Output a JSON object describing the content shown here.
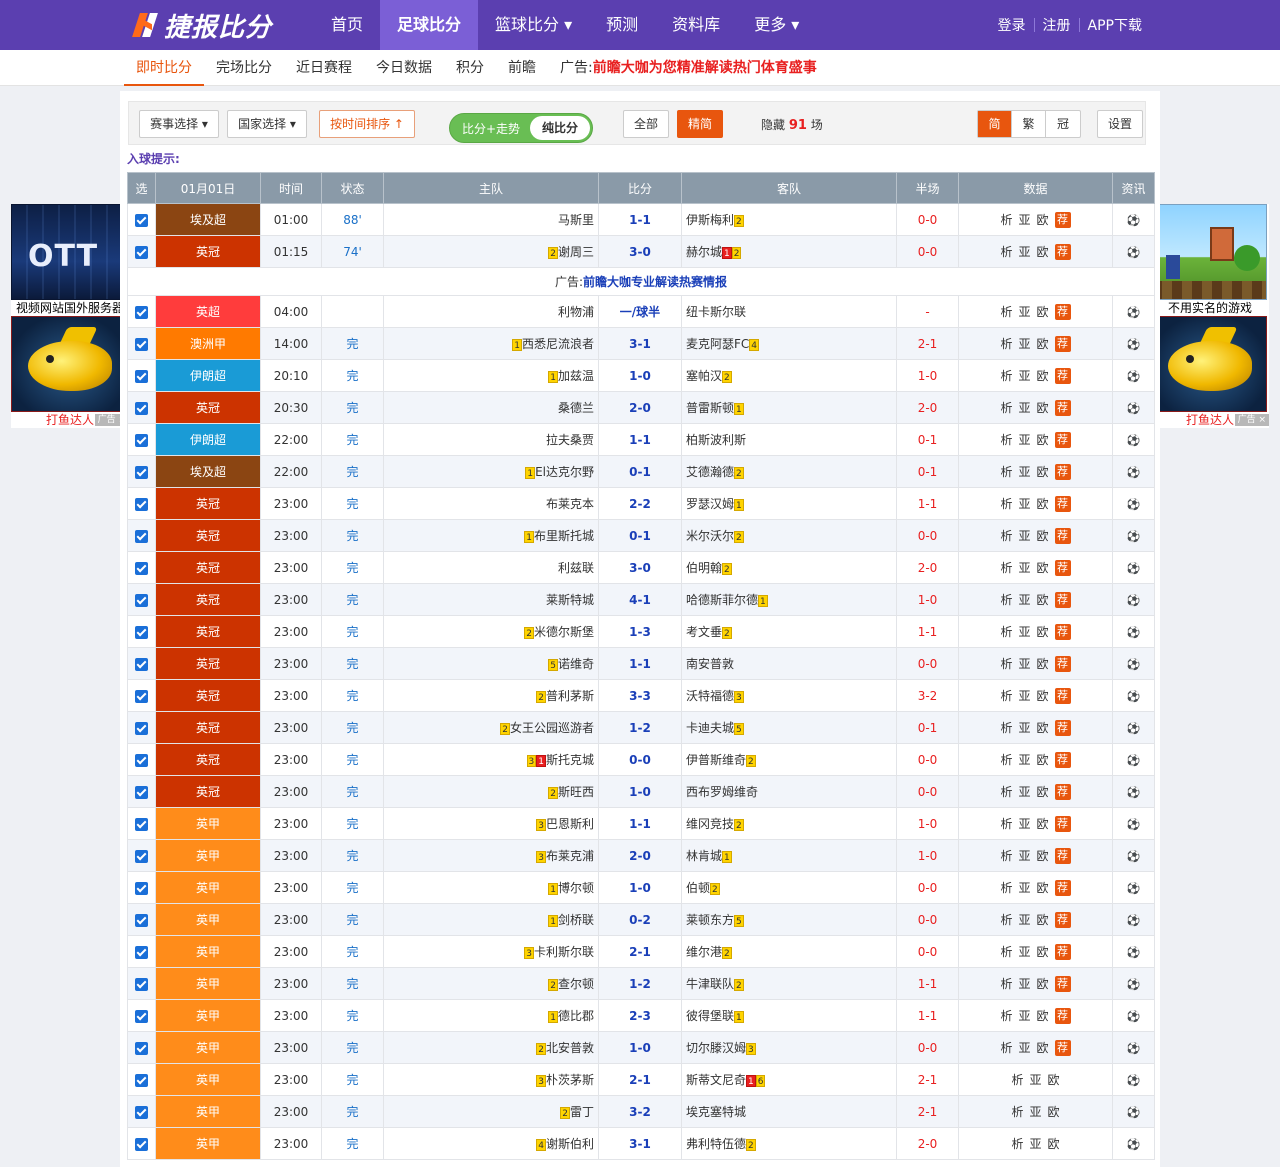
{
  "header": {
    "logo_text": "捷报比分",
    "nav": [
      {
        "label": "首页",
        "active": false
      },
      {
        "label": "足球比分",
        "active": true
      },
      {
        "label": "篮球比分 ▾",
        "active": false
      },
      {
        "label": "预测",
        "active": false
      },
      {
        "label": "资料库",
        "active": false
      },
      {
        "label": "更多 ▾",
        "active": false
      }
    ],
    "right_links": [
      "登录",
      "注册",
      "APP下载"
    ]
  },
  "subnav": {
    "items": [
      "即时比分",
      "完场比分",
      "近日赛程",
      "今日数据",
      "积分",
      "前瞻"
    ],
    "ad_prefix": "广告:",
    "ad_text": "前瞻大咖为您精准解读热门体育盛事"
  },
  "toolbar": {
    "match_select": "赛事选择 ▾",
    "country_select": "国家选择 ▾",
    "sort_by_time": "按时间排序 ↑",
    "toggle_option1": "比分+走势",
    "toggle_option2": "纯比分",
    "all": "全部",
    "featured": "精简",
    "hidden_prefix": "隐藏",
    "hidden_count": "91",
    "hidden_suffix": "场",
    "lang": [
      "简",
      "繁",
      "冠"
    ],
    "settings": "设置"
  },
  "goal_tip": "入球提示:",
  "table": {
    "headers": [
      "选",
      "01月01日",
      "时间",
      "状态",
      "主队",
      "比分",
      "客队",
      "半场",
      "数据",
      "资讯"
    ],
    "data_links": [
      "析",
      "亚",
      "欧"
    ],
    "rec_label": "荐",
    "ad_row": {
      "prefix": "广告:",
      "text": "前瞻大咖专业解读热赛情报"
    },
    "league_colors": {
      "埃及超": "#8b4512",
      "英冠": "#cc3300",
      "英超": "#ff3c3c",
      "澳洲甲": "#ff7a00",
      "伊朗超": "#1a9bd6",
      "英甲": "#ff8c1a"
    },
    "rows_top": [
      {
        "league": "埃及超",
        "time": "01:00",
        "status": "88'",
        "home": "马斯里",
        "home_cards": [],
        "score": "1-1",
        "away": "伊斯梅利",
        "away_cards": [
          {
            "t": "y",
            "n": "2"
          }
        ],
        "ht": "0-0",
        "rec": true
      },
      {
        "league": "英冠",
        "time": "01:15",
        "status": "74'",
        "home": "谢周三",
        "home_cards": [
          {
            "t": "y",
            "n": "2"
          }
        ],
        "score": "3-0",
        "away": "赫尔城",
        "away_cards": [
          {
            "t": "r",
            "n": "1"
          },
          {
            "t": "y",
            "n": "2"
          }
        ],
        "ht": "0-0",
        "rec": true
      }
    ],
    "rows": [
      {
        "league": "英超",
        "time": "04:00",
        "status": "",
        "home": "利物浦",
        "home_cards": [],
        "score": "一/球半",
        "away": "纽卡斯尔联",
        "away_cards": [],
        "ht": "-",
        "rec": true
      },
      {
        "league": "澳洲甲",
        "time": "14:00",
        "status": "完",
        "home": "西悉尼流浪者",
        "home_cards": [
          {
            "t": "y",
            "n": "1"
          }
        ],
        "score": "3-1",
        "away": "麦克阿瑟FC",
        "away_cards": [
          {
            "t": "y",
            "n": "4"
          }
        ],
        "ht": "2-1",
        "rec": true
      },
      {
        "league": "伊朗超",
        "time": "20:10",
        "status": "完",
        "home": "加兹温",
        "home_cards": [
          {
            "t": "y",
            "n": "1"
          }
        ],
        "score": "1-0",
        "away": "塞帕汉",
        "away_cards": [
          {
            "t": "y",
            "n": "2"
          }
        ],
        "ht": "1-0",
        "rec": true
      },
      {
        "league": "英冠",
        "time": "20:30",
        "status": "完",
        "home": "桑德兰",
        "home_cards": [],
        "score": "2-0",
        "away": "普雷斯顿",
        "away_cards": [
          {
            "t": "y",
            "n": "1"
          }
        ],
        "ht": "2-0",
        "rec": true
      },
      {
        "league": "伊朗超",
        "time": "22:00",
        "status": "完",
        "home": "拉夫桑贾",
        "home_cards": [],
        "score": "1-1",
        "away": "柏斯波利斯",
        "away_cards": [],
        "ht": "0-1",
        "rec": true
      },
      {
        "league": "埃及超",
        "time": "22:00",
        "status": "完",
        "home": "El达克尔野",
        "home_cards": [
          {
            "t": "y",
            "n": "1"
          }
        ],
        "score": "0-1",
        "away": "艾德瀚德",
        "away_cards": [
          {
            "t": "y",
            "n": "2"
          }
        ],
        "ht": "0-1",
        "rec": true
      },
      {
        "league": "英冠",
        "time": "23:00",
        "status": "完",
        "home": "布莱克本",
        "home_cards": [],
        "score": "2-2",
        "away": "罗瑟汉姆",
        "away_cards": [
          {
            "t": "y",
            "n": "1"
          }
        ],
        "ht": "1-1",
        "rec": true
      },
      {
        "league": "英冠",
        "time": "23:00",
        "status": "完",
        "home": "布里斯托城",
        "home_cards": [
          {
            "t": "y",
            "n": "1"
          }
        ],
        "score": "0-1",
        "away": "米尔沃尔",
        "away_cards": [
          {
            "t": "y",
            "n": "2"
          }
        ],
        "ht": "0-0",
        "rec": true
      },
      {
        "league": "英冠",
        "time": "23:00",
        "status": "完",
        "home": "利兹联",
        "home_cards": [],
        "score": "3-0",
        "away": "伯明翰",
        "away_cards": [
          {
            "t": "y",
            "n": "2"
          }
        ],
        "ht": "2-0",
        "rec": true
      },
      {
        "league": "英冠",
        "time": "23:00",
        "status": "完",
        "home": "莱斯特城",
        "home_cards": [],
        "score": "4-1",
        "away": "哈德斯菲尔德",
        "away_cards": [
          {
            "t": "y",
            "n": "1"
          }
        ],
        "ht": "1-0",
        "rec": true
      },
      {
        "league": "英冠",
        "time": "23:00",
        "status": "完",
        "home": "米德尔斯堡",
        "home_cards": [
          {
            "t": "y",
            "n": "2"
          }
        ],
        "score": "1-3",
        "away": "考文垂",
        "away_cards": [
          {
            "t": "y",
            "n": "2"
          }
        ],
        "ht": "1-1",
        "rec": true
      },
      {
        "league": "英冠",
        "time": "23:00",
        "status": "完",
        "home": "诺维奇",
        "home_cards": [
          {
            "t": "y",
            "n": "5"
          }
        ],
        "score": "1-1",
        "away": "南安普敦",
        "away_cards": [],
        "ht": "0-0",
        "rec": true
      },
      {
        "league": "英冠",
        "time": "23:00",
        "status": "完",
        "home": "普利茅斯",
        "home_cards": [
          {
            "t": "y",
            "n": "2"
          }
        ],
        "score": "3-3",
        "away": "沃特福德",
        "away_cards": [
          {
            "t": "y",
            "n": "3"
          }
        ],
        "ht": "3-2",
        "rec": true
      },
      {
        "league": "英冠",
        "time": "23:00",
        "status": "完",
        "home": "女王公园巡游者",
        "home_cards": [
          {
            "t": "y",
            "n": "2"
          }
        ],
        "score": "1-2",
        "away": "卡迪夫城",
        "away_cards": [
          {
            "t": "y",
            "n": "5"
          }
        ],
        "ht": "0-1",
        "rec": true
      },
      {
        "league": "英冠",
        "time": "23:00",
        "status": "完",
        "home": "斯托克城",
        "home_cards": [
          {
            "t": "y",
            "n": "3"
          },
          {
            "t": "r",
            "n": "1"
          }
        ],
        "score": "0-0",
        "away": "伊普斯维奇",
        "away_cards": [
          {
            "t": "y",
            "n": "2"
          }
        ],
        "ht": "0-0",
        "rec": true
      },
      {
        "league": "英冠",
        "time": "23:00",
        "status": "完",
        "home": "斯旺西",
        "home_cards": [
          {
            "t": "y",
            "n": "2"
          }
        ],
        "score": "1-0",
        "away": "西布罗姆维奇",
        "away_cards": [],
        "ht": "0-0",
        "rec": true
      },
      {
        "league": "英甲",
        "time": "23:00",
        "status": "完",
        "home": "巴恩斯利",
        "home_cards": [
          {
            "t": "y",
            "n": "3"
          }
        ],
        "score": "1-1",
        "away": "维冈竞技",
        "away_cards": [
          {
            "t": "y",
            "n": "2"
          }
        ],
        "ht": "1-0",
        "rec": true
      },
      {
        "league": "英甲",
        "time": "23:00",
        "status": "完",
        "home": "布莱克浦",
        "home_cards": [
          {
            "t": "y",
            "n": "3"
          }
        ],
        "score": "2-0",
        "away": "林肯城",
        "away_cards": [
          {
            "t": "y",
            "n": "1"
          }
        ],
        "ht": "1-0",
        "rec": true
      },
      {
        "league": "英甲",
        "time": "23:00",
        "status": "完",
        "home": "博尔顿",
        "home_cards": [
          {
            "t": "y",
            "n": "1"
          }
        ],
        "score": "1-0",
        "away": "伯顿",
        "away_cards": [
          {
            "t": "y",
            "n": "2"
          }
        ],
        "ht": "0-0",
        "rec": true
      },
      {
        "league": "英甲",
        "time": "23:00",
        "status": "完",
        "home": "剑桥联",
        "home_cards": [
          {
            "t": "y",
            "n": "1"
          }
        ],
        "score": "0-2",
        "away": "莱顿东方",
        "away_cards": [
          {
            "t": "y",
            "n": "5"
          }
        ],
        "ht": "0-0",
        "rec": true
      },
      {
        "league": "英甲",
        "time": "23:00",
        "status": "完",
        "home": "卡利斯尔联",
        "home_cards": [
          {
            "t": "y",
            "n": "3"
          }
        ],
        "score": "2-1",
        "away": "维尔港",
        "away_cards": [
          {
            "t": "y",
            "n": "2"
          }
        ],
        "ht": "0-0",
        "rec": true
      },
      {
        "league": "英甲",
        "time": "23:00",
        "status": "完",
        "home": "查尔顿",
        "home_cards": [
          {
            "t": "y",
            "n": "2"
          }
        ],
        "score": "1-2",
        "away": "牛津联队",
        "away_cards": [
          {
            "t": "y",
            "n": "2"
          }
        ],
        "ht": "1-1",
        "rec": true
      },
      {
        "league": "英甲",
        "time": "23:00",
        "status": "完",
        "home": "德比郡",
        "home_cards": [
          {
            "t": "y",
            "n": "1"
          }
        ],
        "score": "2-3",
        "away": "彼得堡联",
        "away_cards": [
          {
            "t": "y",
            "n": "1"
          }
        ],
        "ht": "1-1",
        "rec": true
      },
      {
        "league": "英甲",
        "time": "23:00",
        "status": "完",
        "home": "北安普敦",
        "home_cards": [
          {
            "t": "y",
            "n": "2"
          }
        ],
        "score": "1-0",
        "away": "切尔滕汉姆",
        "away_cards": [
          {
            "t": "y",
            "n": "3"
          }
        ],
        "ht": "0-0",
        "rec": true
      },
      {
        "league": "英甲",
        "time": "23:00",
        "status": "完",
        "home": "朴茨茅斯",
        "home_cards": [
          {
            "t": "y",
            "n": "3"
          }
        ],
        "score": "2-1",
        "away": "斯蒂文尼奇",
        "away_cards": [
          {
            "t": "r",
            "n": "1"
          },
          {
            "t": "y",
            "n": "6"
          }
        ],
        "ht": "2-1",
        "rec": false
      },
      {
        "league": "英甲",
        "time": "23:00",
        "status": "完",
        "home": "雷丁",
        "home_cards": [
          {
            "t": "y",
            "n": "2"
          }
        ],
        "score": "3-2",
        "away": "埃克塞特城",
        "away_cards": [],
        "ht": "2-1",
        "rec": false
      },
      {
        "league": "英甲",
        "time": "23:00",
        "status": "完",
        "home": "谢斯伯利",
        "home_cards": [
          {
            "t": "y",
            "n": "4"
          }
        ],
        "score": "3-1",
        "away": "弗利特伍德",
        "away_cards": [
          {
            "t": "y",
            "n": "2"
          }
        ],
        "ht": "2-0",
        "rec": false
      }
    ]
  },
  "side_ads": {
    "left_top_caption": "视频网站国外服务器",
    "left_top_logo": "OTT",
    "left_bottom_caption": "打鱼达人",
    "right_top_caption": "不用实名的游戏",
    "right_bottom_caption": "打鱼达人",
    "close_label": "广告 ×"
  }
}
